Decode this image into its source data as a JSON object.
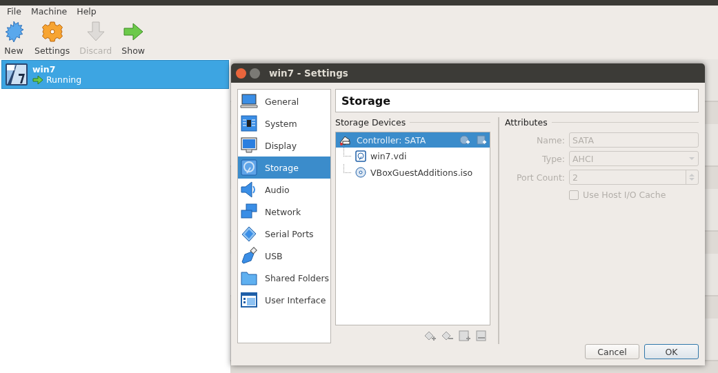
{
  "menu": [
    {
      "label": "File"
    },
    {
      "label": "Machine"
    },
    {
      "label": "Help"
    }
  ],
  "toolbar": [
    {
      "label": "New",
      "kind": "new",
      "disabled": false
    },
    {
      "label": "Settings",
      "kind": "settings",
      "disabled": false
    },
    {
      "label": "Discard",
      "kind": "discard",
      "disabled": true
    },
    {
      "label": "Show",
      "kind": "show",
      "disabled": false
    }
  ],
  "vm_list": [
    {
      "name": "win7",
      "state": "Running",
      "selected": true
    }
  ],
  "dialog": {
    "title": "win7 - Settings",
    "sections": [
      {
        "label": "General",
        "selected": false
      },
      {
        "label": "System",
        "selected": false
      },
      {
        "label": "Display",
        "selected": false
      },
      {
        "label": "Storage",
        "selected": true
      },
      {
        "label": "Audio",
        "selected": false
      },
      {
        "label": "Network",
        "selected": false
      },
      {
        "label": "Serial Ports",
        "selected": false
      },
      {
        "label": "USB",
        "selected": false
      },
      {
        "label": "Shared Folders",
        "selected": false
      },
      {
        "label": "User Interface",
        "selected": false
      }
    ],
    "page_title": "Storage",
    "devices_label": "Storage Devices",
    "tree": [
      {
        "label": "Controller: SATA",
        "kind": "controller",
        "selected": true,
        "children": [
          {
            "label": "win7.vdi",
            "kind": "hdd",
            "selected": false
          },
          {
            "label": "VBoxGuestAdditions.iso",
            "kind": "cd",
            "selected": false
          }
        ]
      }
    ],
    "attributes_label": "Attributes",
    "attributes": [
      {
        "label": "Name:",
        "kind": "text",
        "value": "SATA",
        "disabled": true
      },
      {
        "label": "Type:",
        "kind": "select",
        "value": "AHCI",
        "disabled": true
      },
      {
        "label": "Port Count:",
        "kind": "spin",
        "value": "2",
        "disabled": true
      },
      {
        "label": "Use Host I/O Cache",
        "kind": "checkbox",
        "checked": false,
        "disabled": true
      }
    ],
    "buttons": [
      {
        "label": "Cancel",
        "default": false
      },
      {
        "label": "OK",
        "default": true
      }
    ]
  }
}
